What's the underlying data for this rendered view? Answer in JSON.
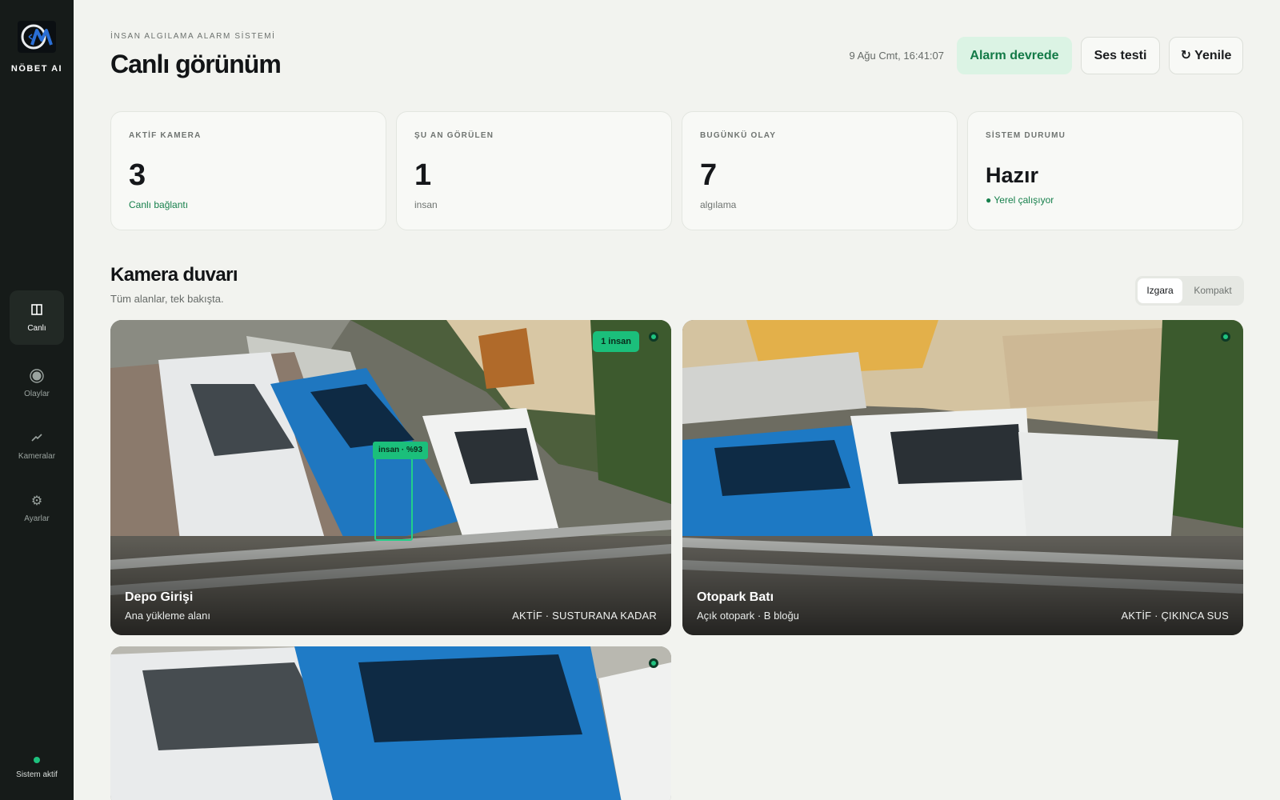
{
  "sidebar": {
    "brand": "NÖBET AI",
    "nav": [
      {
        "label": "Canlı",
        "icon": "columns-icon",
        "active": true
      },
      {
        "label": "Olaylar",
        "icon": "record-icon"
      },
      {
        "label": "Kameralar",
        "icon": "camera-icon"
      },
      {
        "label": "Ayarlar",
        "icon": "gear-icon"
      }
    ],
    "status": "Sistem aktif"
  },
  "header": {
    "eyebrow": "İNSAN ALGILAMA ALARM SİSTEMİ",
    "title": "Canlı görünüm",
    "timestamp": "9 Ağu Cmt, 16:41:07",
    "alarm_button": "Alarm devrede",
    "sound_button": "Ses testi",
    "refresh_button": "↻ Yenile"
  },
  "stats": [
    {
      "label": "AKTİF KAMERA",
      "value": "3",
      "sub": "Canlı bağlantı"
    },
    {
      "label": "ŞU AN GÖRÜLEN",
      "value": "1",
      "sub": "insan"
    },
    {
      "label": "BUGÜNKÜ OLAY",
      "value": "7",
      "sub": "algılama"
    },
    {
      "label": "SİSTEM DURUMU",
      "value": "Hazır",
      "sub": "● Yerel çalışıyor"
    }
  ],
  "wall": {
    "title": "Kamera duvarı",
    "subtitle": "Tüm alanlar, tek bakışta.",
    "view_options": [
      "Izgara",
      "Kompakt"
    ],
    "selected_view": "Izgara"
  },
  "cameras": [
    {
      "name": "Depo Girişi",
      "location": "Ana yükleme alanı",
      "mode": "AKTİF · SUSTURANA KADAR",
      "badge": "1 insan",
      "detection": "insan · %93"
    },
    {
      "name": "Otopark Batı",
      "location": "Açık otopark · B bloğu",
      "mode": "AKTİF · ÇIKINCA SUS"
    },
    {
      "name": "",
      "location": "",
      "mode": ""
    }
  ],
  "colors": {
    "sidebar_bg": "#161b19",
    "accent_green": "#1bbf7b",
    "alarm_bg": "#dbf3e4",
    "page_bg": "#f2f3ef"
  }
}
